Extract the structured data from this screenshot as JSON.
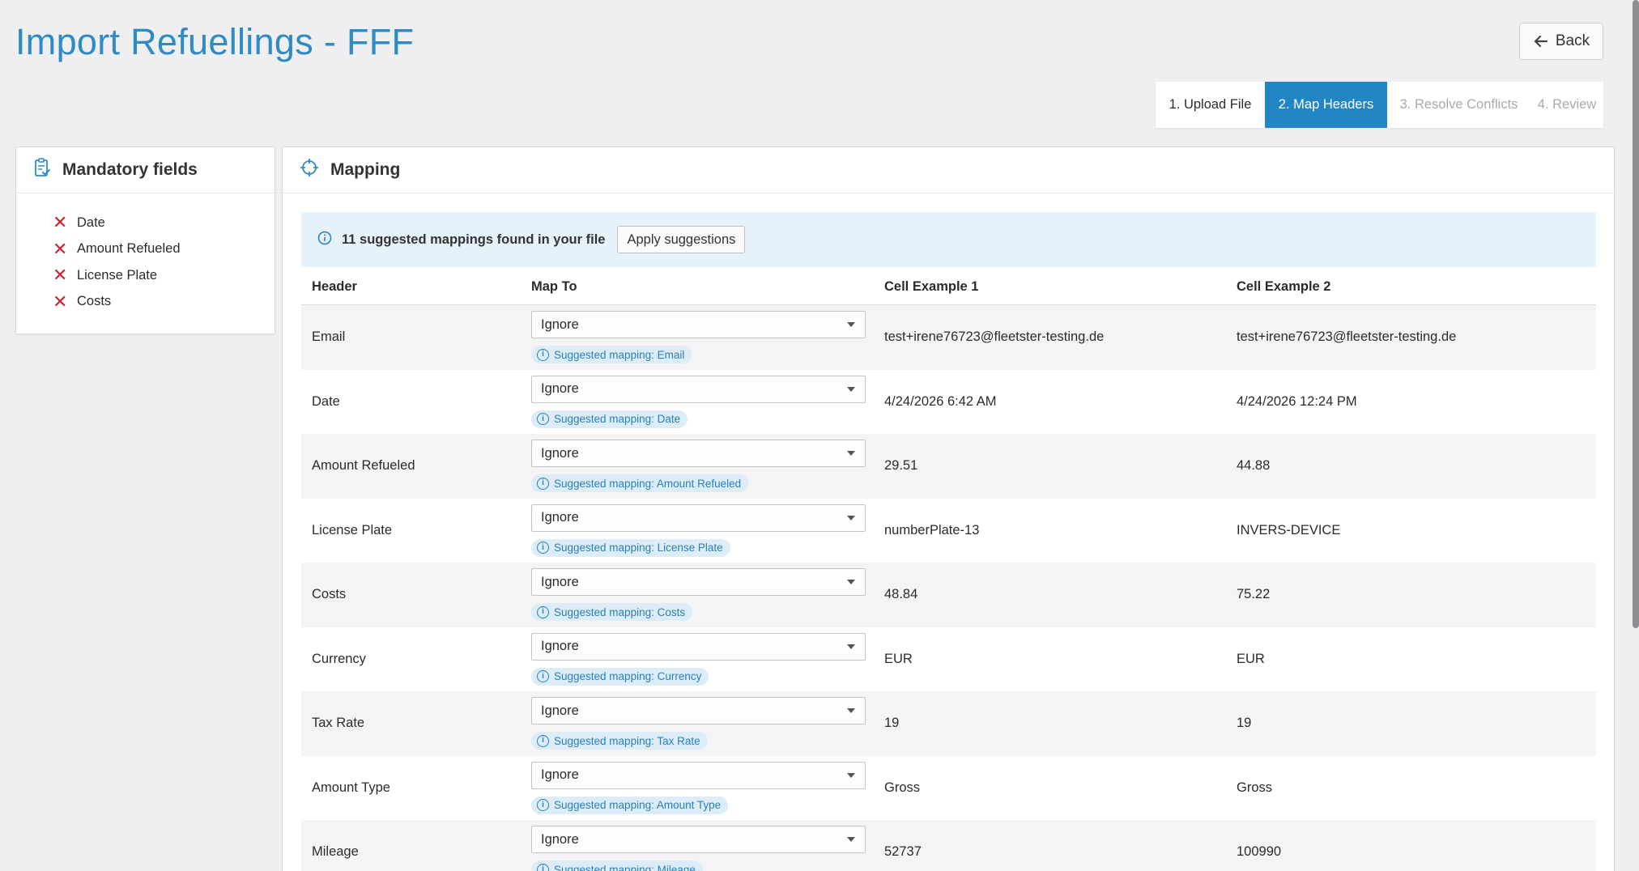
{
  "page": {
    "title": "Import Refuellings - FFF"
  },
  "back_button": {
    "label": "Back"
  },
  "stepper": {
    "steps": [
      {
        "label": "1. Upload File",
        "state": "done"
      },
      {
        "label": "2. Map Headers",
        "state": "active"
      },
      {
        "label": "3. Resolve Conflicts",
        "state": "pending"
      },
      {
        "label": "4. Review",
        "state": "pending"
      }
    ]
  },
  "mandatory": {
    "title": "Mandatory fields",
    "items": [
      "Date",
      "Amount Refueled",
      "License Plate",
      "Costs"
    ]
  },
  "mapping": {
    "title": "Mapping",
    "banner": {
      "text": "11 suggested mappings found in your file",
      "apply_label": "Apply suggestions"
    },
    "columns": [
      "Header",
      "Map To",
      "Cell Example 1",
      "Cell Example 2"
    ],
    "rows": [
      {
        "header": "Email",
        "map_to": "Ignore",
        "suggestion": "Suggested mapping: Email",
        "ex1": "test+irene76723@fleetster-testing.de",
        "ex2": "test+irene76723@fleetster-testing.de"
      },
      {
        "header": "Date",
        "map_to": "Ignore",
        "suggestion": "Suggested mapping: Date",
        "ex1": "4/24/2026 6:42 AM",
        "ex2": "4/24/2026 12:24 PM"
      },
      {
        "header": "Amount Refueled",
        "map_to": "Ignore",
        "suggestion": "Suggested mapping: Amount Refueled",
        "ex1": "29.51",
        "ex2": "44.88"
      },
      {
        "header": "License Plate",
        "map_to": "Ignore",
        "suggestion": "Suggested mapping: License Plate",
        "ex1": "numberPlate-13",
        "ex2": "INVERS-DEVICE"
      },
      {
        "header": "Costs",
        "map_to": "Ignore",
        "suggestion": "Suggested mapping: Costs",
        "ex1": "48.84",
        "ex2": "75.22"
      },
      {
        "header": "Currency",
        "map_to": "Ignore",
        "suggestion": "Suggested mapping: Currency",
        "ex1": "EUR",
        "ex2": "EUR"
      },
      {
        "header": "Tax Rate",
        "map_to": "Ignore",
        "suggestion": "Suggested mapping: Tax Rate",
        "ex1": "19",
        "ex2": "19"
      },
      {
        "header": "Amount Type",
        "map_to": "Ignore",
        "suggestion": "Suggested mapping: Amount Type",
        "ex1": "Gross",
        "ex2": "Gross"
      },
      {
        "header": "Mileage",
        "map_to": "Ignore",
        "suggestion": "Suggested mapping: Mileage",
        "ex1": "52737",
        "ex2": "100990"
      }
    ]
  },
  "colors": {
    "accent": "#2186c3",
    "title": "#2f8bc4",
    "error_mark": "#c9232d",
    "banner_bg": "#e6f2f9",
    "page_bg": "#efeef1"
  },
  "icons": {
    "back": "arrow-left-icon",
    "mandatory": "clipboard-check-icon",
    "mapping": "crosshair-icon",
    "info": "info-circle-icon",
    "missing": "x-mark-icon",
    "dropdown": "caret-down-icon"
  }
}
